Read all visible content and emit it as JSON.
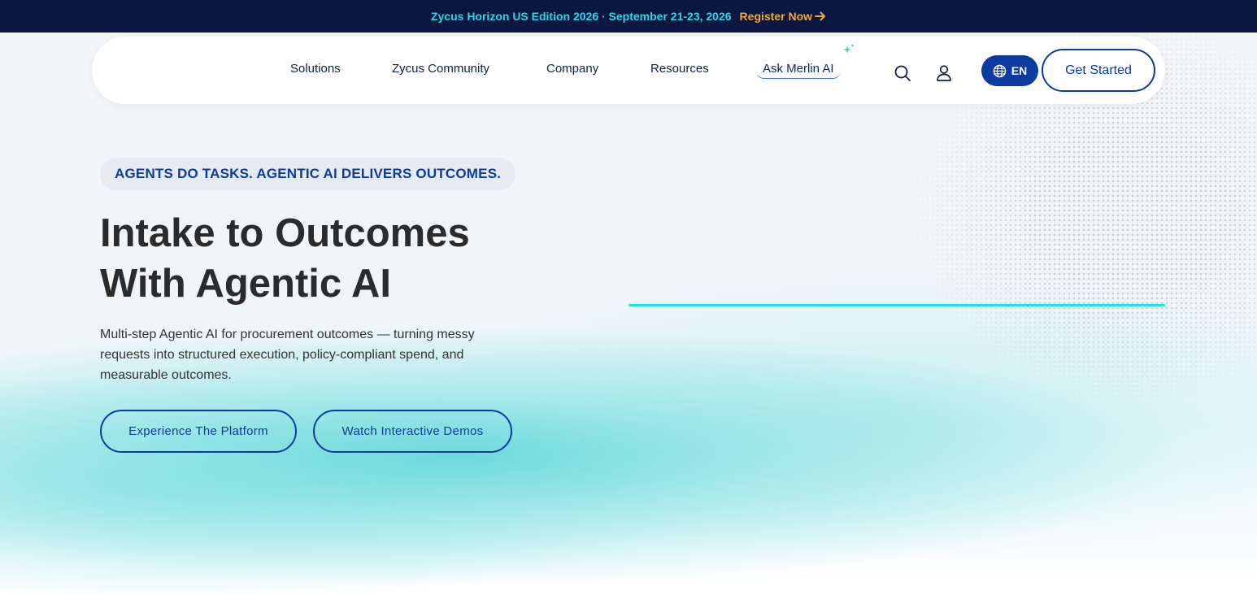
{
  "topbar": {
    "event_text": "Zycus Horizon US Edition 2026 · September 21-23, 2026",
    "register_label": "Register Now"
  },
  "nav": {
    "items": [
      {
        "label": "Solutions"
      },
      {
        "label": "Zycus Community"
      },
      {
        "label": "Company"
      },
      {
        "label": "Resources"
      }
    ],
    "ask_merlin": "Ask Merlin AI",
    "language": "EN",
    "cta": "Get Started"
  },
  "hero": {
    "eyebrow": "AGENTS DO TASKS. AGENTIC AI DELIVERS OUTCOMES.",
    "headline_line1": "Intake to Outcomes",
    "headline_line2": "With Agentic AI",
    "subcopy": "Multi-step Agentic AI for procurement outcomes — turning messy requests into structured execution, policy-compliant spend, and measurable outcomes.",
    "primary_button": "Experience The Platform",
    "secondary_button": "Watch Interactive Demos"
  },
  "colors": {
    "topbar_bg": "#0b1740",
    "event_text": "#2ad7e6",
    "register_text": "#f0a73a",
    "brand_blue": "#0b3aa0",
    "accent_teal": "#21e3de"
  },
  "icons": [
    "arrow-right-icon",
    "sparkle-icon",
    "search-icon",
    "user-icon",
    "globe-icon"
  ]
}
